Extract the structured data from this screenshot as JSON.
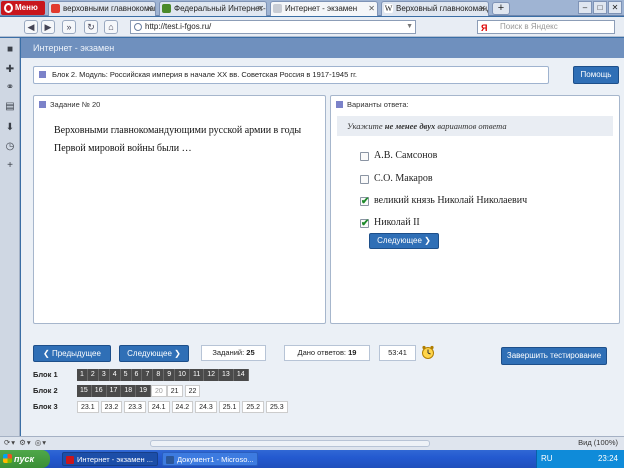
{
  "browser": {
    "menu_label": "Меню",
    "tabs": [
      {
        "title": "верховными главнокоманд...",
        "active": false,
        "icon_color": "#e23a2e"
      },
      {
        "title": "Федеральный Интернет-...",
        "active": false,
        "icon_color": "#4a8a2a"
      },
      {
        "title": "Интернет - экзамен",
        "active": true,
        "icon_color": "#c8ccd4"
      },
      {
        "title": "Верховный главнокоманд...",
        "active": false,
        "icon_color": "#ffffff"
      }
    ],
    "tab_icons": [
      "youtube-icon",
      "edge-icon",
      "page-icon",
      "wikipedia-icon"
    ],
    "new_tab_label": "+",
    "url": "http://test.i-fgos.ru/",
    "search_placeholder": "Поиск в Яндекс",
    "search_engine_label": "Я"
  },
  "page": {
    "header": "Интернет - экзамен",
    "block_title": "Блок 2. Модуль: Российская империя в начале XX вв. Советская Россия в 1917-1945 гг.",
    "help_label": "Помощь",
    "task_label": "Задание № 20",
    "question": "Верховными главнокомандующими русской армии в годы Первой мировой войны были …",
    "answers_label": "Варианты ответа:",
    "instruction": {
      "prefix": "Укажите ",
      "bold": "не менее двух",
      "suffix": " вариантов ответа"
    },
    "options": [
      {
        "label": "А.В. Самсонов",
        "checked": false
      },
      {
        "label": "С.О. Макаров",
        "checked": false
      },
      {
        "label": "великий князь Николай Николаевич",
        "checked": true
      },
      {
        "label": "Николай II",
        "checked": true
      }
    ],
    "next_inner_label": "Следующее",
    "prev_label": "Предыдущее",
    "next_label": "Следующее",
    "tasks_label": "Заданий:",
    "tasks_count": "25",
    "answered_label": "Дано ответов:",
    "answered_count": "19",
    "timer": "53:41",
    "finish_label": "Завершить тестирование",
    "blocks": [
      {
        "label": "Блок 1",
        "cells": [
          {
            "n": "1",
            "state": "done"
          },
          {
            "n": "2",
            "state": "done"
          },
          {
            "n": "3",
            "state": "done"
          },
          {
            "n": "4",
            "state": "done"
          },
          {
            "n": "5",
            "state": "done"
          },
          {
            "n": "6",
            "state": "done"
          },
          {
            "n": "7",
            "state": "done"
          },
          {
            "n": "8",
            "state": "done"
          },
          {
            "n": "9",
            "state": "done"
          },
          {
            "n": "10",
            "state": "done"
          },
          {
            "n": "11",
            "state": "done"
          },
          {
            "n": "12",
            "state": "done"
          },
          {
            "n": "13",
            "state": "done"
          },
          {
            "n": "14",
            "state": "done"
          }
        ]
      },
      {
        "label": "Блок 2",
        "cells": [
          {
            "n": "15",
            "state": "done"
          },
          {
            "n": "16",
            "state": "done"
          },
          {
            "n": "17",
            "state": "done"
          },
          {
            "n": "18",
            "state": "done"
          },
          {
            "n": "19",
            "state": "done"
          },
          {
            "n": "20",
            "state": "cur"
          },
          {
            "n": "21",
            "state": "todo"
          },
          {
            "n": "22",
            "state": "todo"
          }
        ]
      },
      {
        "label": "Блок 3",
        "cells": [
          {
            "n": "23.1",
            "state": "todo"
          },
          {
            "n": "23.2",
            "state": "todo"
          },
          {
            "n": "23.3",
            "state": "todo"
          },
          {
            "n": "24.1",
            "state": "todo"
          },
          {
            "n": "24.2",
            "state": "todo"
          },
          {
            "n": "24.3",
            "state": "todo"
          },
          {
            "n": "25.1",
            "state": "todo"
          },
          {
            "n": "25.2",
            "state": "todo"
          },
          {
            "n": "25.3",
            "state": "todo"
          }
        ]
      }
    ]
  },
  "statusbar": {
    "zoom": "Вид (100%)"
  },
  "taskbar": {
    "start_label": "пуск",
    "tasks": [
      {
        "title": "Интернет - экзамен ...",
        "color": "#c8161d"
      },
      {
        "title": "Документ1 - Microso...",
        "color": "#2b579a"
      }
    ],
    "lang": "RU",
    "time": "23:24"
  },
  "colors": {
    "accent": "#2f6fb6",
    "header": "#6f90be",
    "square": "#7b82c9"
  }
}
